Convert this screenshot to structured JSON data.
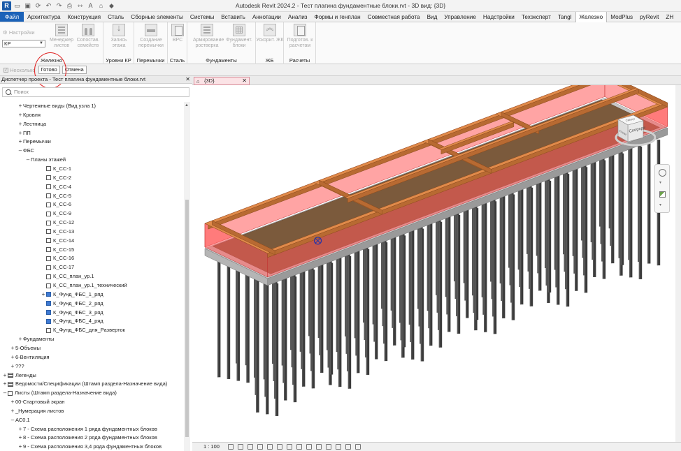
{
  "window": {
    "title": "Autodesk Revit 2024.2 - Тест плагина фундаментные блоки.rvt - 3D вид: {3D}",
    "logo": "R"
  },
  "tabs": [
    "Файл",
    "Архитектура",
    "Конструкция",
    "Сталь",
    "Сборные элементы",
    "Системы",
    "Вставить",
    "Аннотации",
    "Анализ",
    "Формы и генплан",
    "Совместная работа",
    "Вид",
    "Управление",
    "Надстройки",
    "Техэксперт",
    "Tangl",
    "Железно",
    "ModPlus",
    "pyRevit",
    "ZH"
  ],
  "active_tab": "Железно",
  "ribbon": {
    "settings_label": "Настройки",
    "kr_value": "КР",
    "groups": [
      {
        "title": "Железно",
        "buttons": [
          "Менеджер листов",
          "Сопостав. семейств"
        ]
      },
      {
        "title": "Уровни КР",
        "buttons": [
          "Запись этажа"
        ]
      },
      {
        "title": "Перемычки",
        "buttons": [
          "Создание перемычки"
        ]
      },
      {
        "title": "Сталь",
        "buttons": [
          "ВРС"
        ]
      },
      {
        "title": "Фундаменты",
        "buttons": [
          "Армирование ростверка",
          "Фундамент. блоки"
        ]
      },
      {
        "title": "ЖБ",
        "buttons": [
          "Ускорит. ЖК"
        ]
      },
      {
        "title": "Расчеты",
        "buttons": [
          "Подготов. к расчетам"
        ]
      }
    ]
  },
  "options_bar": {
    "multiple_label": "Несколько",
    "done_label": "Готово",
    "cancel_label": "Отмена"
  },
  "project_browser": {
    "title": "Диспетчер проекта - Тест плагина фундаментные блоки.rvt",
    "search_placeholder": "Поиск",
    "items": [
      {
        "label": "Чертежные виды (Вид узла 1)",
        "indent": 2,
        "exp": "+",
        "icon": ""
      },
      {
        "label": "Кровля",
        "indent": 2,
        "exp": "+",
        "icon": ""
      },
      {
        "label": "Лестница",
        "indent": 2,
        "exp": "+",
        "icon": ""
      },
      {
        "label": "ПП",
        "indent": 2,
        "exp": "+",
        "icon": ""
      },
      {
        "label": "Перемычки",
        "indent": 2,
        "exp": "+",
        "icon": ""
      },
      {
        "label": "ФБС",
        "indent": 2,
        "exp": "–",
        "icon": ""
      },
      {
        "label": "Планы этажей",
        "indent": 3,
        "exp": "–",
        "icon": ""
      },
      {
        "label": "К_СС-1",
        "indent": 5,
        "exp": "",
        "icon": "sheet"
      },
      {
        "label": "К_СС-2",
        "indent": 5,
        "exp": "",
        "icon": "sheet"
      },
      {
        "label": "К_СС-4",
        "indent": 5,
        "exp": "",
        "icon": "sheet"
      },
      {
        "label": "К_СС-5",
        "indent": 5,
        "exp": "",
        "icon": "sheet"
      },
      {
        "label": "К_СС-6",
        "indent": 5,
        "exp": "",
        "icon": "sheet"
      },
      {
        "label": "К_СС-9",
        "indent": 5,
        "exp": "",
        "icon": "sheet"
      },
      {
        "label": "К_СС-12",
        "indent": 5,
        "exp": "",
        "icon": "sheet"
      },
      {
        "label": "К_СС-13",
        "indent": 5,
        "exp": "",
        "icon": "sheet"
      },
      {
        "label": "К_СС-14",
        "indent": 5,
        "exp": "",
        "icon": "sheet"
      },
      {
        "label": "К_СС-15",
        "indent": 5,
        "exp": "",
        "icon": "sheet"
      },
      {
        "label": "К_СС-16",
        "indent": 5,
        "exp": "",
        "icon": "sheet"
      },
      {
        "label": "К_СС-17",
        "indent": 5,
        "exp": "",
        "icon": "sheet"
      },
      {
        "label": "К_СС_план_ур.1",
        "indent": 5,
        "exp": "",
        "icon": "sheet"
      },
      {
        "label": "К_СС_план_ур.1_технический",
        "indent": 5,
        "exp": "",
        "icon": "sheet"
      },
      {
        "label": "К_Фунд_ФБС_1_ряд",
        "indent": 5,
        "exp": "+",
        "icon": "blue"
      },
      {
        "label": "К_Фунд_ФБС_2_ряд",
        "indent": 5,
        "exp": "",
        "icon": "blue"
      },
      {
        "label": "К_Фунд_ФБС_3_ряд",
        "indent": 5,
        "exp": "",
        "icon": "blue"
      },
      {
        "label": "К_Фунд_ФБС_4_ряд",
        "indent": 5,
        "exp": "",
        "icon": "blue"
      },
      {
        "label": "К_Фунд_ФБС_для_Разверток",
        "indent": 5,
        "exp": "",
        "icon": "sheet"
      },
      {
        "label": "Фундаменты",
        "indent": 2,
        "exp": "+",
        "icon": ""
      },
      {
        "label": "5-Объемы",
        "indent": 1,
        "exp": "+",
        "icon": ""
      },
      {
        "label": "6-Вентиляция",
        "indent": 1,
        "exp": "+",
        "icon": ""
      },
      {
        "label": "???",
        "indent": 1,
        "exp": "+",
        "icon": ""
      },
      {
        "label": "Легенды",
        "indent": 0,
        "exp": "+",
        "icon": "table"
      },
      {
        "label": "Ведомости/Спецификации (Штамп раздела-Назначение вида)",
        "indent": 0,
        "exp": "+",
        "icon": "table"
      },
      {
        "label": "Листы (Штамп раздела-Назначение вида)",
        "indent": 0,
        "exp": "–",
        "icon": "sheet"
      },
      {
        "label": "00-Стартовый экран",
        "indent": 1,
        "exp": "+",
        "icon": ""
      },
      {
        "label": "_Нумерация листов",
        "indent": 1,
        "exp": "+",
        "icon": ""
      },
      {
        "label": "АС0.1",
        "indent": 1,
        "exp": "–",
        "icon": ""
      },
      {
        "label": "7 - Схема расположения 1 ряда фундаментных блоков",
        "indent": 2,
        "exp": "+",
        "icon": ""
      },
      {
        "label": "8 - Схема расположения 2 ряда фундаментных блоков",
        "indent": 2,
        "exp": "+",
        "icon": ""
      },
      {
        "label": "9 - Схема расположения 3,4 ряда фундаментных блоков",
        "indent": 2,
        "exp": "+",
        "icon": ""
      }
    ]
  },
  "view": {
    "tab_label": "{3D}",
    "scale": "1 : 100",
    "viewcube_labels": [
      "Сверху",
      "Спереди",
      "Слева"
    ]
  },
  "colors": {
    "accent": "#1b62b8",
    "beam": "#e08a4a",
    "wall_red": "#ff5a5a",
    "slab": "#7b5a3c",
    "pile": "#3a3a3a"
  }
}
